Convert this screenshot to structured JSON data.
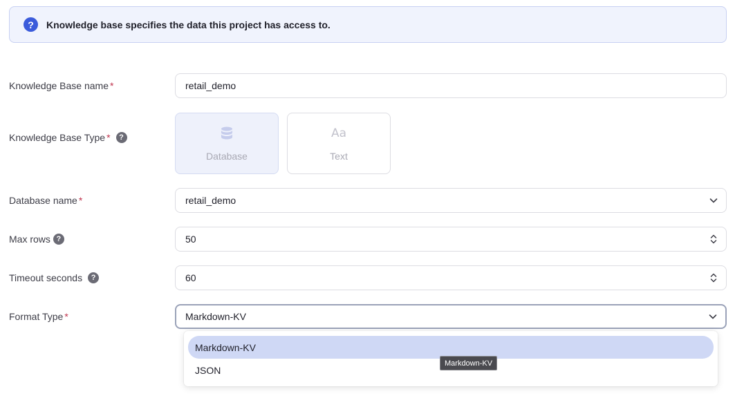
{
  "banner": {
    "text": "Knowledge base specifies the data this project has access to.",
    "icon": "question-circle-icon"
  },
  "form": {
    "kb_name": {
      "label": "Knowledge Base name",
      "required": "*",
      "value": "retail_demo"
    },
    "kb_type": {
      "label": "Knowledge Base Type",
      "required": "*",
      "options": [
        {
          "label": "Database",
          "icon": "database-icon",
          "selected": true
        },
        {
          "label": "Text",
          "icon": "text-aa-icon",
          "selected": false
        }
      ]
    },
    "db_name": {
      "label": "Database name",
      "required": "*",
      "value": "retail_demo"
    },
    "max_rows": {
      "label": "Max rows",
      "value": "50"
    },
    "timeout": {
      "label": "Timeout seconds",
      "value": "60"
    },
    "format_type": {
      "label": "Format Type",
      "required": "*",
      "value": "Markdown-KV",
      "options": [
        "Markdown-KV",
        "JSON"
      ]
    }
  },
  "tooltip": {
    "text": "Markdown-KV"
  },
  "colors": {
    "accent": "#3b5bdb",
    "required": "#c0334d",
    "option_highlight": "#cfd8f5"
  }
}
